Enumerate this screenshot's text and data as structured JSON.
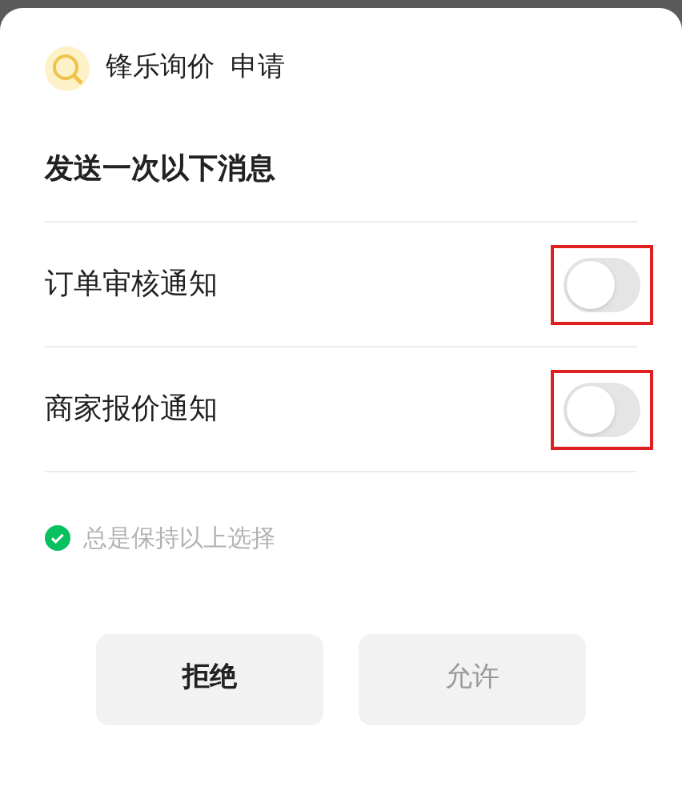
{
  "header": {
    "app_name": "锋乐询价",
    "action": "申请"
  },
  "title": "发送一次以下消息",
  "items": [
    {
      "label": "订单审核通知",
      "on": false,
      "highlighted": true
    },
    {
      "label": "商家报价通知",
      "on": false,
      "highlighted": true
    }
  ],
  "remember": {
    "label": "总是保持以上选择",
    "checked": true
  },
  "buttons": [
    {
      "label": "拒绝",
      "disabled": false
    },
    {
      "label": "允许",
      "disabled": true
    }
  ]
}
